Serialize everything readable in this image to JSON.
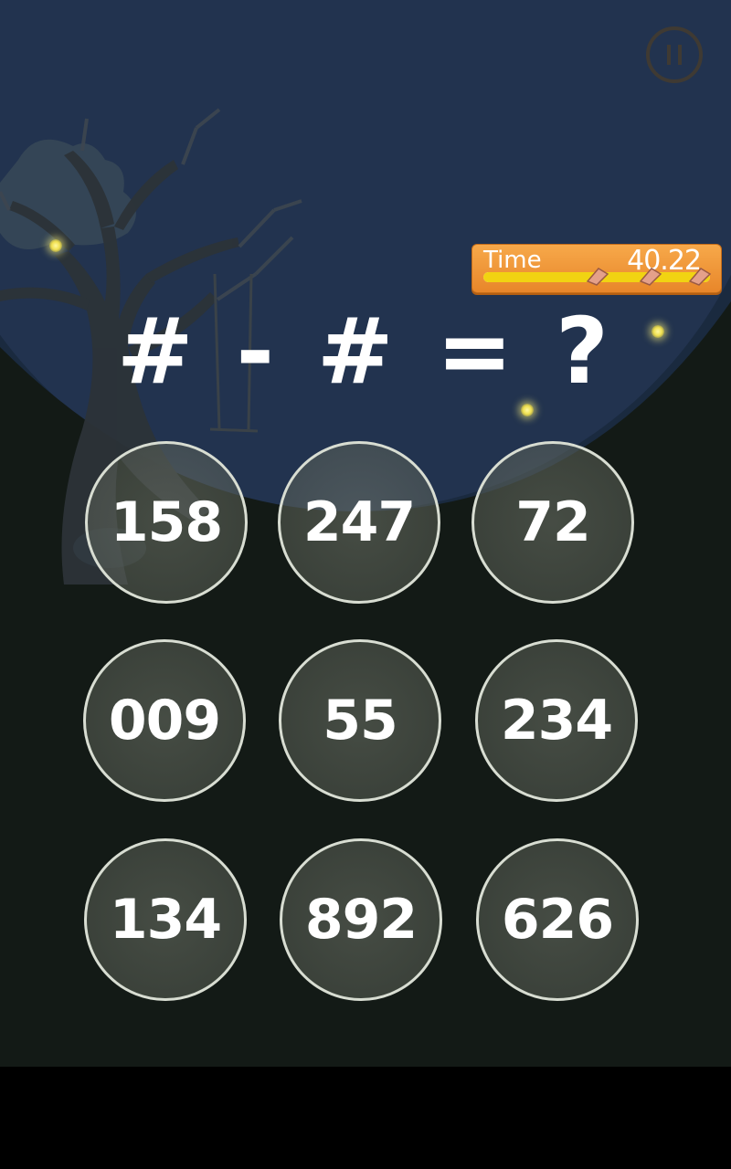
{
  "game": {
    "equation": "# - # = ?",
    "timer": {
      "label": "Time",
      "value": "40.22",
      "progress": 1.0,
      "stars": 3
    },
    "answers": [
      "158",
      "247",
      "72",
      "009",
      "55",
      "234",
      "134",
      "892",
      "626"
    ]
  },
  "colors": {
    "sky": "#1a2a3f",
    "moon": "#2a3c5e",
    "ground": "#131a16",
    "timer_orange": "#f09a3c",
    "timer_fill": "#f1d312",
    "button_ring": "#d8ddd2"
  },
  "icons": {
    "pause": "pause-icon",
    "star": "star-icon",
    "firefly": "firefly"
  }
}
